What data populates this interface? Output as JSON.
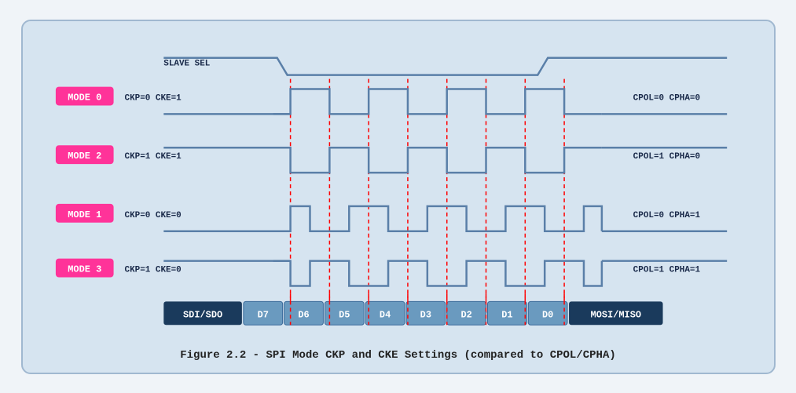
{
  "caption": "Figure 2.2 - SPI Mode CKP and CKE Settings (compared to CPOL/CPHA)",
  "slave_sel_label": "SLAVE SEL",
  "modes": [
    {
      "label": "MODE 0",
      "ckp_cke": "CKP=0  CKE=1",
      "cpol_cpha": "CPOL=0  CPHA=0"
    },
    {
      "label": "MODE 2",
      "ckp_cke": "CKP=1  CKE=1",
      "cpol_cpha": "CPOL=1  CPHA=0"
    },
    {
      "label": "MODE 1",
      "ckp_cke": "CKP=0  CKE=0",
      "cpol_cpha": "CPOL=0  CPHA=1"
    },
    {
      "label": "MODE 3",
      "ckp_cke": "CKP=1  CKE=0",
      "cpol_cpha": "CPOL=1  CPHA=1"
    }
  ],
  "data_labels": [
    "SDI/SDO",
    "D7",
    "D6",
    "D5",
    "D4",
    "D3",
    "D2",
    "D1",
    "D0",
    "MOSI/MISO"
  ],
  "colors": {
    "mode_bg": "#ff3399",
    "mode_text": "#ffffff",
    "waveform": "#5a7fa8",
    "dashed_line": "#ff0000",
    "data_bar_dark": "#1a3a5c",
    "data_bar_light": "#6a9abf",
    "background": "#d6e4f0"
  }
}
